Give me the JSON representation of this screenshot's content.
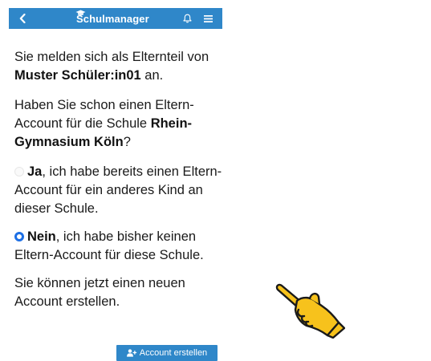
{
  "nav": {
    "back_icon": "chevron-left-icon",
    "brand": "Schulmanager",
    "brand_icon": "graduation-cap-icon",
    "bell_icon": "bell-icon",
    "menu_icon": "hamburger-menu-icon",
    "bar_color": "#2f87c9"
  },
  "intro": {
    "text1": "Sie melden sich als Elternteil von ",
    "student": "Muster Schüler:in01",
    "text2": " an."
  },
  "question": {
    "text1": "Haben Sie schon einen Eltern-Account für die Schule ",
    "school": "Rhein-Gymnasium Köln",
    "text2": "?"
  },
  "options": [
    {
      "bold": "Ja",
      "rest": ", ich habe bereits einen Eltern-Account für ein anderes Kind an dieser Schule.",
      "selected": false
    },
    {
      "bold": "Nein",
      "rest": ", ich habe bisher keinen Eltern-Account für diese Schule.",
      "selected": true
    }
  ],
  "note": "Sie können jetzt einen neuen Account erstellen.",
  "button": {
    "label": "Account erstellen",
    "icon": "add-user-icon"
  },
  "decor": {
    "pointer_icon": "pointing-hand-icon",
    "hand_color": "#f7c21c"
  }
}
